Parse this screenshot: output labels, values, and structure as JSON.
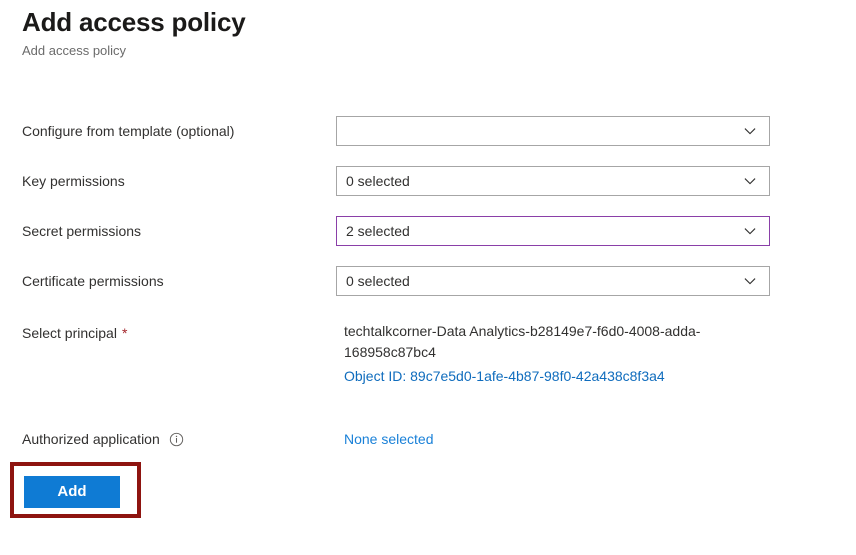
{
  "header": {
    "title": "Add access policy",
    "subtitle": "Add access policy"
  },
  "form": {
    "rows": [
      {
        "label": "Configure from template (optional)",
        "type": "dropdown",
        "value": "",
        "accent": false
      },
      {
        "label": "Key permissions",
        "type": "dropdown",
        "value": "0 selected",
        "accent": false
      },
      {
        "label": "Secret permissions",
        "type": "dropdown",
        "value": "2 selected",
        "accent": true
      },
      {
        "label": "Certificate permissions",
        "type": "dropdown",
        "value": "0 selected",
        "accent": false
      },
      {
        "label": "Select principal",
        "type": "principal",
        "required": true,
        "principal_name": "techtalkcorner-Data Analytics-b28149e7-f6d0-4008-adda-168958c87bc4",
        "object_id": "Object ID: 89c7e5d0-1afe-4b87-98f0-42a438c8f3a4"
      },
      {
        "label": "Authorized application",
        "type": "link",
        "info_icon": "info-icon",
        "value": "None selected"
      }
    ]
  },
  "footer": {
    "add_label": "Add"
  },
  "icons": {
    "chevron": "chevron-down-icon",
    "info": "info-icon"
  },
  "colors": {
    "accent_blue": "#0f7bd4",
    "link_blue": "#1a81d8",
    "object_id_blue": "#0f6cbd",
    "required_red": "#a4262c",
    "annotation_red": "#8e1410",
    "field_border": "#a6a6a6",
    "field_border_accent": "#8a3fa8",
    "subtitle_gray": "#6b6b6b"
  }
}
